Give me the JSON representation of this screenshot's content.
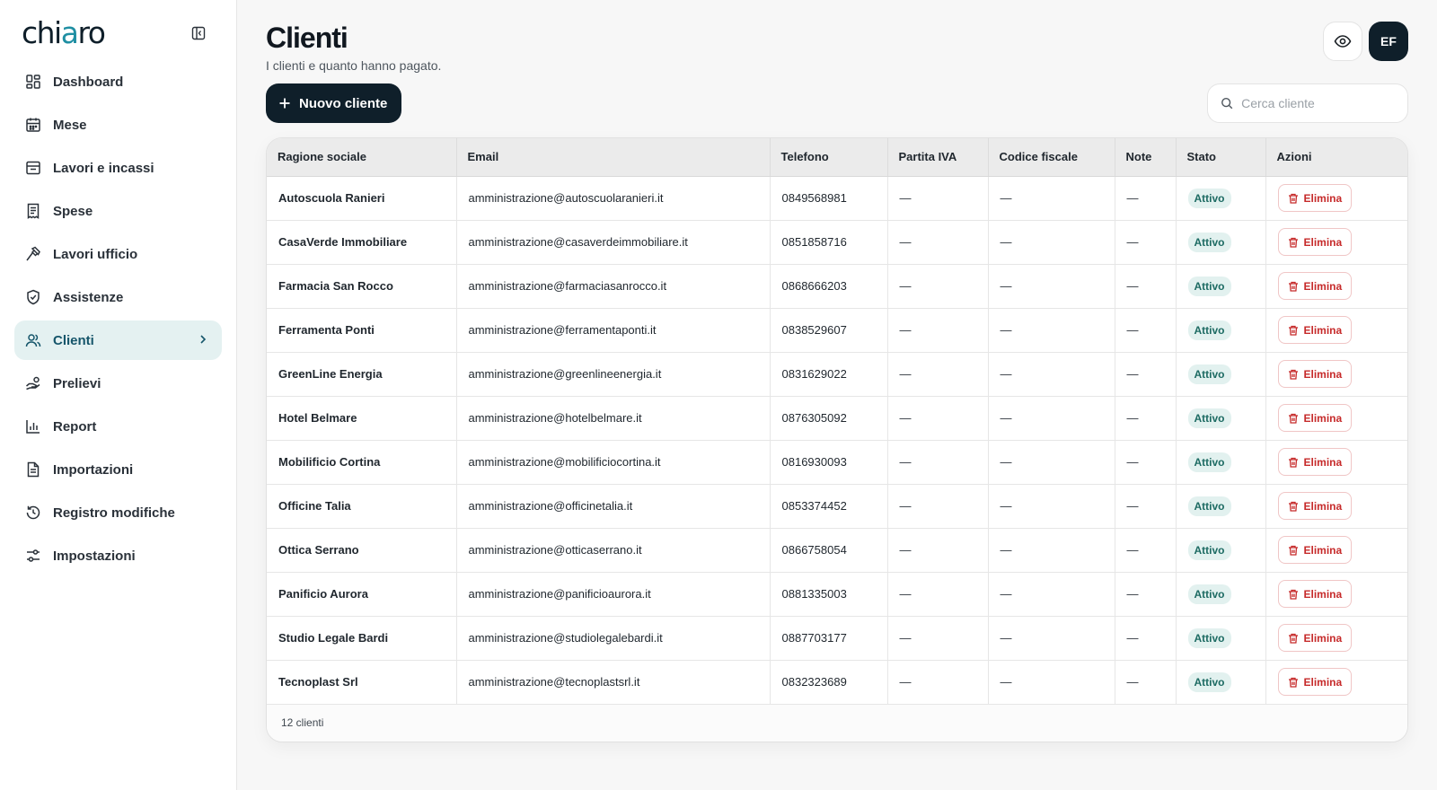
{
  "brand": {
    "name_start": "chi",
    "name_accent": "a",
    "name_end": "ro"
  },
  "sidebar": {
    "items": [
      {
        "label": "Dashboard",
        "icon": "dashboard-icon"
      },
      {
        "label": "Mese",
        "icon": "calendar-icon"
      },
      {
        "label": "Lavori e incassi",
        "icon": "inbox-icon"
      },
      {
        "label": "Spese",
        "icon": "receipt-icon"
      },
      {
        "label": "Lavori ufficio",
        "icon": "hammer-icon"
      },
      {
        "label": "Assistenze",
        "icon": "shield-icon"
      },
      {
        "label": "Clienti",
        "icon": "users-icon",
        "active": true
      },
      {
        "label": "Prelievi",
        "icon": "hand-coins-icon"
      },
      {
        "label": "Report",
        "icon": "bar-chart-icon"
      },
      {
        "label": "Importazioni",
        "icon": "file-import-icon"
      },
      {
        "label": "Registro modifiche",
        "icon": "history-icon"
      },
      {
        "label": "Impostazioni",
        "icon": "settings-icon"
      }
    ]
  },
  "header": {
    "title": "Clienti",
    "subtitle": "I clienti e quanto hanno pagato.",
    "avatar_initials": "EF"
  },
  "toolbar": {
    "new_button_label": "Nuovo cliente",
    "search_placeholder": "Cerca cliente"
  },
  "table": {
    "columns": [
      "Ragione sociale",
      "Email",
      "Telefono",
      "Partita IVA",
      "Codice fiscale",
      "Note",
      "Stato",
      "Azioni"
    ],
    "delete_label": "Elimina",
    "rows": [
      {
        "name": "Autoscuola Ranieri",
        "email": "amministrazione@autoscuolaranieri.it",
        "phone": "0849568981",
        "vat": "—",
        "tax_code": "—",
        "notes": "—",
        "status": "Attivo"
      },
      {
        "name": "CasaVerde Immobiliare",
        "email": "amministrazione@casaverdeimmobiliare.it",
        "phone": "0851858716",
        "vat": "—",
        "tax_code": "—",
        "notes": "—",
        "status": "Attivo"
      },
      {
        "name": "Farmacia San Rocco",
        "email": "amministrazione@farmaciasanrocco.it",
        "phone": "0868666203",
        "vat": "—",
        "tax_code": "—",
        "notes": "—",
        "status": "Attivo"
      },
      {
        "name": "Ferramenta Ponti",
        "email": "amministrazione@ferramentaponti.it",
        "phone": "0838529607",
        "vat": "—",
        "tax_code": "—",
        "notes": "—",
        "status": "Attivo"
      },
      {
        "name": "GreenLine Energia",
        "email": "amministrazione@greenlineenergia.it",
        "phone": "0831629022",
        "vat": "—",
        "tax_code": "—",
        "notes": "—",
        "status": "Attivo"
      },
      {
        "name": "Hotel Belmare",
        "email": "amministrazione@hotelbelmare.it",
        "phone": "0876305092",
        "vat": "—",
        "tax_code": "—",
        "notes": "—",
        "status": "Attivo"
      },
      {
        "name": "Mobilificio Cortina",
        "email": "amministrazione@mobilificiocortina.it",
        "phone": "0816930093",
        "vat": "—",
        "tax_code": "—",
        "notes": "—",
        "status": "Attivo"
      },
      {
        "name": "Officine Talia",
        "email": "amministrazione@officinetalia.it",
        "phone": "0853374452",
        "vat": "—",
        "tax_code": "—",
        "notes": "—",
        "status": "Attivo"
      },
      {
        "name": "Ottica Serrano",
        "email": "amministrazione@otticaserrano.it",
        "phone": "0866758054",
        "vat": "—",
        "tax_code": "—",
        "notes": "—",
        "status": "Attivo"
      },
      {
        "name": "Panificio Aurora",
        "email": "amministrazione@panificioaurora.it",
        "phone": "0881335003",
        "vat": "—",
        "tax_code": "—",
        "notes": "—",
        "status": "Attivo"
      },
      {
        "name": "Studio Legale Bardi",
        "email": "amministrazione@studiolegalebardi.it",
        "phone": "0887703177",
        "vat": "—",
        "tax_code": "—",
        "notes": "—",
        "status": "Attivo"
      },
      {
        "name": "Tecnoplast Srl",
        "email": "amministrazione@tecnoplastsrl.it",
        "phone": "0832323689",
        "vat": "—",
        "tax_code": "—",
        "notes": "—",
        "status": "Attivo"
      }
    ],
    "footer_count": "12 clienti"
  },
  "colors": {
    "primary_dark": "#0f1f2a",
    "active_nav_bg": "#e4f1f1",
    "active_nav_text": "#15556a",
    "status_badge_bg": "#e2f1ef",
    "status_badge_text": "#1d6b63",
    "danger": "#c62a2a"
  }
}
